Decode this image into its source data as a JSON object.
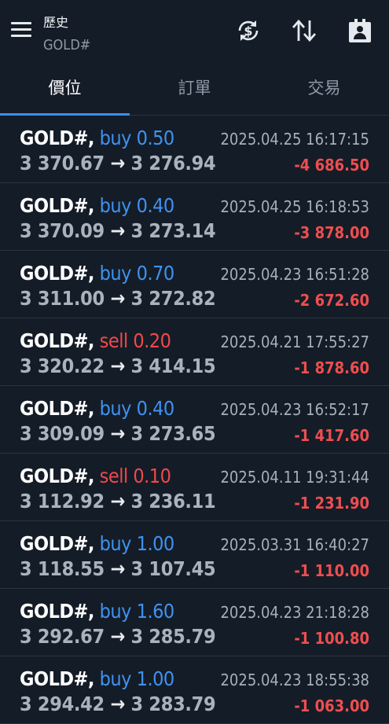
{
  "header": {
    "title": "歷史",
    "subtitle": "GOLD#"
  },
  "tabs": [
    "價位",
    "訂單",
    "交易"
  ],
  "rows": [
    {
      "symbol": "GOLD#,",
      "side": "buy",
      "volume": "0.50",
      "open": "3 370.67",
      "close": "3 276.94",
      "time": "2025.04.25 16:17:15",
      "profit": "-4 686.50"
    },
    {
      "symbol": "GOLD#,",
      "side": "buy",
      "volume": "0.40",
      "open": "3 370.09",
      "close": "3 273.14",
      "time": "2025.04.25 16:18:53",
      "profit": "-3 878.00"
    },
    {
      "symbol": "GOLD#,",
      "side": "buy",
      "volume": "0.70",
      "open": "3 311.00",
      "close": "3 272.82",
      "time": "2025.04.23 16:51:28",
      "profit": "-2 672.60"
    },
    {
      "symbol": "GOLD#,",
      "side": "sell",
      "volume": "0.20",
      "open": "3 320.22",
      "close": "3 414.15",
      "time": "2025.04.21 17:55:27",
      "profit": "-1 878.60"
    },
    {
      "symbol": "GOLD#,",
      "side": "buy",
      "volume": "0.40",
      "open": "3 309.09",
      "close": "3 273.65",
      "time": "2025.04.23 16:52:17",
      "profit": "-1 417.60"
    },
    {
      "symbol": "GOLD#,",
      "side": "sell",
      "volume": "0.10",
      "open": "3 112.92",
      "close": "3 236.11",
      "time": "2025.04.11 19:31:44",
      "profit": "-1 231.90"
    },
    {
      "symbol": "GOLD#,",
      "side": "buy",
      "volume": "1.00",
      "open": "3 118.55",
      "close": "3 107.45",
      "time": "2025.03.31 16:40:27",
      "profit": "-1 110.00"
    },
    {
      "symbol": "GOLD#,",
      "side": "buy",
      "volume": "1.60",
      "open": "3 292.67",
      "close": "3 285.79",
      "time": "2025.04.23 21:18:28",
      "profit": "-1 100.80"
    },
    {
      "symbol": "GOLD#,",
      "side": "buy",
      "volume": "1.00",
      "open": "3 294.42",
      "close": "3 283.79",
      "time": "2025.04.23 18:55:38",
      "profit": "-1 063.00"
    }
  ],
  "arrow": "→",
  "icons": [
    "menu-icon",
    "sync-dollar-icon",
    "sort-icon",
    "portfolio-icon"
  ],
  "colors": {
    "background": "#141c27",
    "buy": "#3f92f0",
    "sell": "#f0494a",
    "loss": "#ee4e4f",
    "accent": "#3f8ef7"
  }
}
